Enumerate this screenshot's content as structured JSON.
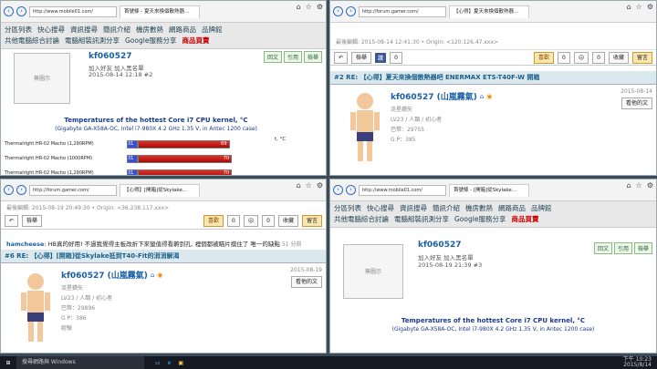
{
  "forum": {
    "menu1": [
      "分區列表",
      "快心搜尋",
      "資訊搜尋",
      "簡訊介紹",
      "機房數熱",
      "網路商品",
      "品牌館"
    ],
    "menu2": [
      "共他電腦綜合討論",
      "電腦組裝訊測分享",
      "Google服務分享",
      "商品買賣"
    ],
    "placeholder": "無圖示",
    "username": "kf060527",
    "add_friend": "加入好友",
    "add_blacklist": "加入黑名單",
    "btn_reply_quote": "回文",
    "btn_quote": "引用",
    "btn_report": "檢舉",
    "btn_edit": "編輯",
    "chart_title": "Temperatures of the hottest Core i7 CPU kernel, °C",
    "chart_sub": "(Gigabyte GA-X58A-OC, Intel i7-980X 4.2 GHz 1.35 V, in Antec 1200 case)",
    "axis_unit": "t, °C"
  },
  "p1": {
    "url": "http://www.mobile01.com/",
    "tab": "首號條 - 夏天來換個散熱器...",
    "date": "2015-08-14 12:18",
    "post": "#2"
  },
  "p2": {
    "url": "http://forum.gamer.com/",
    "tab": "【心得】夏天來換個散熱器...",
    "meta": "最後編輯: 2015-08-14 12:41:30 • Origin: <120.126.47.xxx>",
    "title": "#2 RE: 【心得】夏天來換個散熱器吧 ENERMAX ETS-T40F-W 開箱",
    "uname": "kf060527 (山嵐霧氣)",
    "date": "2015-08-14",
    "level": "LV23 / 人類 / 初心者",
    "coins": "巴幣：29755",
    "gp": "G P：385",
    "fb_like": "讚",
    "fb_count": "0",
    "tooltip": "看他的文"
  },
  "p3": {
    "url": "http://forum.gamer.com/",
    "tab": "【心得】[開箱]從Skylake...",
    "meta": "最後編輯: 2015-08-19 20:49:30 • Origin: <36.238.117.xxx>",
    "comment_user": "hamcheese",
    "comment_text": "HB真的好用! 不過我覺得主板改折下來蠻值得看齁到孔. 裡個都被瞄片擋住了 唯一的缺點",
    "comment_time": "51 分前",
    "title": "#6 RE: 【心得】[開箱]從Skylake抵到T40-Fit的消消解渴",
    "uname": "kf060527 (山嵐霧氣)",
    "date": "2015-08-19",
    "level": "LV23 / 人類 / 初心者",
    "coins": "巴幣：29896",
    "gp": "G P：386",
    "exp": "經驗",
    "tooltip": "看他的文",
    "votes": [
      "0",
      "0"
    ]
  },
  "p4": {
    "url": "http://www.mobile01.com/",
    "tab": "首號條 - [開箱]從Skylake...",
    "date": "2015-08-19 21:39",
    "post": "#3"
  },
  "toolbar": {
    "like": "喜歡",
    "votes": [
      "0",
      "0"
    ],
    "collect": "收藏",
    "reply": "留言",
    "back": "↶",
    "report": "檢舉"
  },
  "chart_data": {
    "type": "bar",
    "title": "Temperatures of the hottest Core i7 CPU kernel, °C",
    "subtitle": "(Gigabyte GA-X58A-OC, Intel i7-980X 4.2 GHz 1.35 V, in Antec 1200 case)",
    "xlabel": "t, °C",
    "categories": [
      "Thermalright HR-02 Macho (1,290RPM)",
      "Thermalright HR-02 Macho (1000RPM)",
      "Thermalright HR-02 Macho (1,290RPM)"
    ],
    "series": [
      {
        "values": [
          31,
          31,
          31
        ]
      },
      {
        "values": [
          69,
          70,
          70
        ]
      }
    ]
  },
  "taskbar": {
    "search": "搜尋網路與 Windows",
    "time": "下午 10:23",
    "date": "2015/8/14"
  }
}
